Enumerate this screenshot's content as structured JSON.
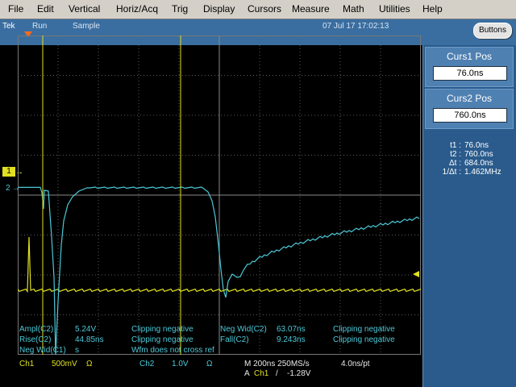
{
  "menu": [
    "File",
    "Edit",
    "Vertical",
    "Horiz/Acq",
    "Trig",
    "Display",
    "Cursors",
    "Measure",
    "Math",
    "Utilities",
    "Help"
  ],
  "status": {
    "brand": "Tek",
    "run": "Run",
    "mode": "Sample",
    "datetime": "07 Jul 17 17:02:13",
    "buttons": "Buttons"
  },
  "panel": {
    "curs1_title": "Curs1 Pos",
    "curs1_value": "76.0ns",
    "curs2_title": "Curs2 Pos",
    "curs2_value": "760.0ns",
    "readouts": [
      {
        "label": "t1 :",
        "value": "76.0ns"
      },
      {
        "label": "t2 :",
        "value": "760.0ns"
      },
      {
        "label": "Δt :",
        "value": "684.0ns"
      },
      {
        "label": "1/Δt :",
        "value": "1.462MHz"
      }
    ]
  },
  "markers": {
    "ch1": "1",
    "ch2": "2"
  },
  "measurements": {
    "ampl_label": "Ampl(C2)",
    "ampl_value": "5.24V",
    "ampl_status": "Clipping negative",
    "rise_label": "Rise(C2)",
    "rise_value": "44.85ns",
    "rise_status": "Clipping negative",
    "negwid1_label": "Neg Wid(C1)",
    "negwid1_value": "s",
    "negwid2_label": "Neg Wid(C2)",
    "negwid2_value": "63.07ns",
    "negwid2_status": "Clipping negative",
    "fall_label": "Fall(C2)",
    "fall_value": "9.243ns",
    "fall_status": "Clipping negative",
    "warning": "Wfm does not cross ref"
  },
  "bottom": {
    "ch1_label": "Ch1",
    "ch1_scale": "500mV",
    "ch1_coupling": "Ω",
    "ch2_label": "Ch2",
    "ch2_scale": "1.0V",
    "ch2_coupling": "Ω",
    "timebase": "M 200ns 250MS/s",
    "resolution": "4.0ns/pt",
    "trig_source_prefix": "A",
    "trig_source": "Ch1",
    "trig_slope": "/",
    "trig_level": "-1.28V"
  },
  "colors": {
    "ch1": "#e0e020",
    "ch2": "#4cc9d8",
    "cursor": "#e0e020",
    "panel": "#2a5b8c",
    "statusbar": "#3a6ea0"
  },
  "icons": {
    "trigger_position": "orange-down-triangle-icon",
    "ch1_level": "yellow-left-arrow-icon"
  }
}
